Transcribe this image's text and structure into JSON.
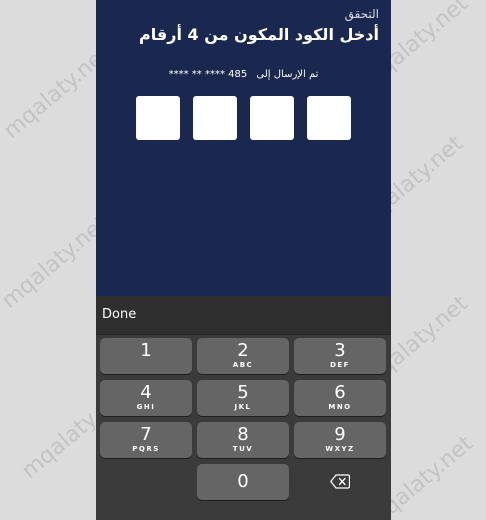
{
  "header": {
    "subtitle": "التحقق",
    "title": "أدخل الكود المكون من 4 أرقام"
  },
  "verification": {
    "sent_label": "تم الإرسال إلى",
    "masked_number": "**** ** **** 485",
    "code_length": 4
  },
  "keyboard": {
    "done_label": "Done",
    "keys": [
      {
        "digit": "1",
        "letters": ""
      },
      {
        "digit": "2",
        "letters": "ABC"
      },
      {
        "digit": "3",
        "letters": "DEF"
      },
      {
        "digit": "4",
        "letters": "GHI"
      },
      {
        "digit": "5",
        "letters": "JKL"
      },
      {
        "digit": "6",
        "letters": "MNO"
      },
      {
        "digit": "7",
        "letters": "PQRS"
      },
      {
        "digit": "8",
        "letters": "TUV"
      },
      {
        "digit": "9",
        "letters": "WXYZ"
      },
      {
        "digit": "0",
        "letters": ""
      }
    ],
    "backspace_icon": "backspace-icon"
  },
  "watermark": {
    "text": "mqalaty.net"
  },
  "colors": {
    "screen_background": "#1a2850",
    "keyboard_background": "#3b3b3b",
    "key_background": "#656565",
    "code_box": "#ffffff"
  }
}
